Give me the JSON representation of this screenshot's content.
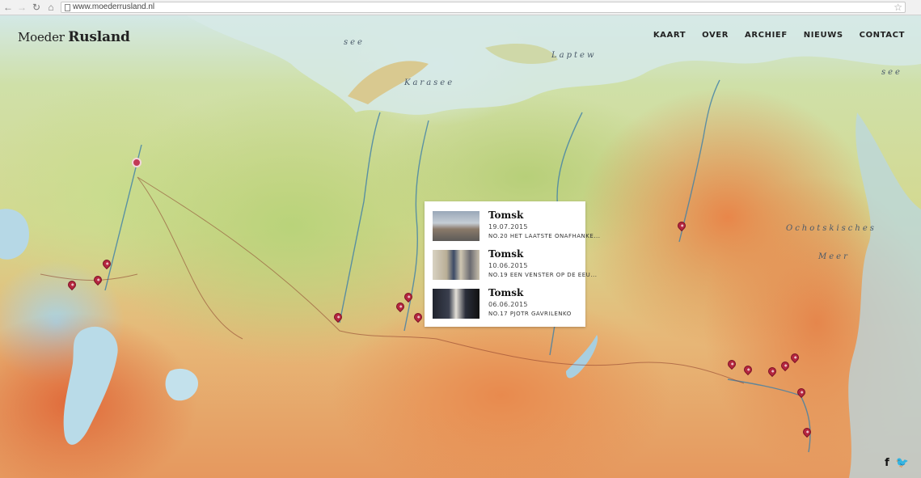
{
  "browser": {
    "back_icon": "back-arrow-icon",
    "forward_icon": "forward-arrow-icon",
    "reload_icon": "reload-icon",
    "home_icon": "home-icon",
    "url": "www.moederrusland.nl",
    "bookmark_icon": "star-icon"
  },
  "site": {
    "logo_light": "Moeder",
    "logo_bold": "Rusland"
  },
  "menu": {
    "items": [
      {
        "label": "KAART"
      },
      {
        "label": "OVER"
      },
      {
        "label": "ARCHIEF"
      },
      {
        "label": "NIEUWS"
      },
      {
        "label": "CONTACT"
      }
    ]
  },
  "map_labels": {
    "laptew": "Laptew",
    "karasee": "Karasee",
    "see": "see",
    "ochotskisches": "Ochotskisches",
    "meer": "Meer",
    "see_right": "see"
  },
  "popup": {
    "entries": [
      {
        "title": "Tomsk",
        "date": "19.07.2015",
        "subtitle": "NO.20 HET LAATSTE ONAFHANKE..."
      },
      {
        "title": "Tomsk",
        "date": "10.06.2015",
        "subtitle": "NO.19 EEN VENSTER OP DE EEU..."
      },
      {
        "title": "Tomsk",
        "date": "06.06.2015",
        "subtitle": "NO.17 PJOTR GAVRILENKO"
      }
    ]
  },
  "social": {
    "facebook": "f",
    "twitter": "🐦"
  },
  "colors": {
    "pin": "#b5263f",
    "moscow_marker": "#c23a56",
    "text": "#222222"
  }
}
